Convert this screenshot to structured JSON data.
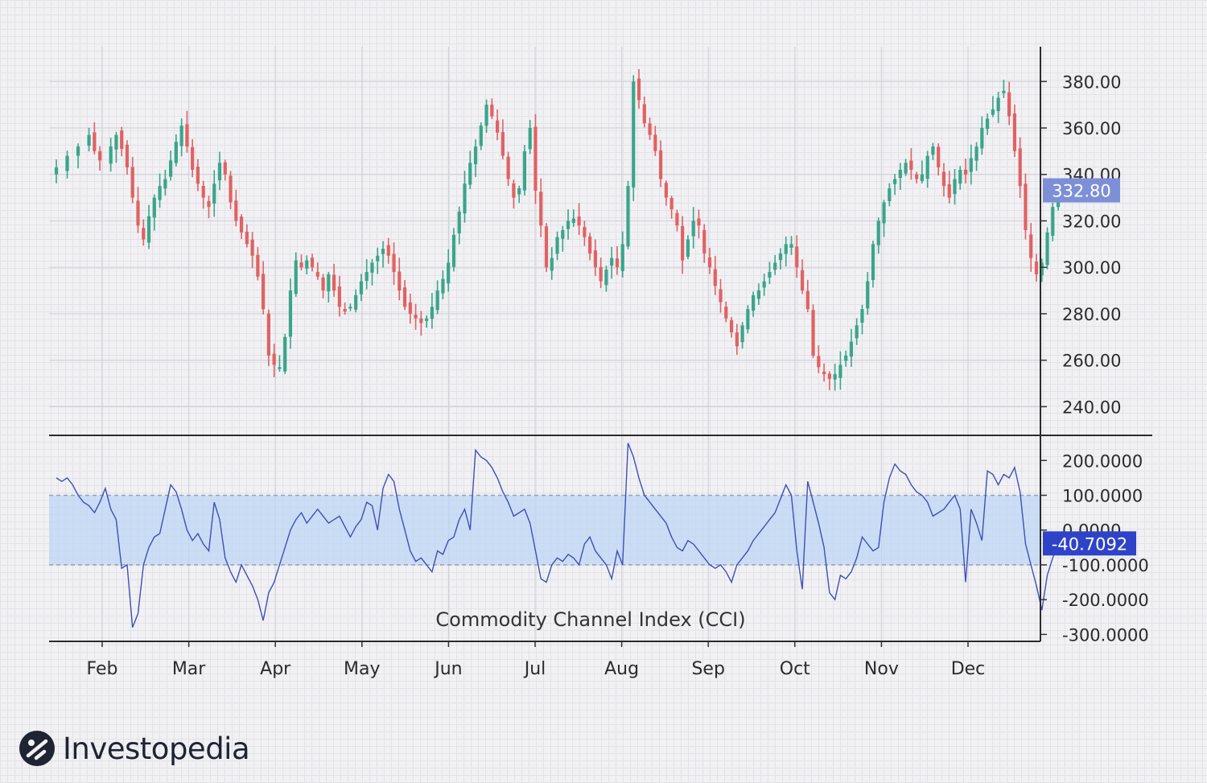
{
  "chart_data": [
    {
      "type": "candlestick",
      "title": "",
      "months": [
        "Feb",
        "Mar",
        "Apr",
        "May",
        "Jun",
        "Jul",
        "Aug",
        "Sep",
        "Oct",
        "Nov",
        "Dec"
      ],
      "ylim": [
        228,
        395
      ],
      "y_ticks": [
        "240.00",
        "260.00",
        "280.00",
        "300.00",
        "320.00",
        "340.00",
        "360.00",
        "380.00"
      ],
      "last_price_label": "332.80",
      "last_price": 332.8,
      "colors": {
        "up": "#3aa58a",
        "down": "#e06262",
        "last_price_badge": "#7d8fd6"
      },
      "close_series": [
        [
          0,
          343
        ],
        [
          2,
          348
        ],
        [
          4,
          352
        ],
        [
          6,
          357
        ],
        [
          7,
          350
        ],
        [
          8,
          346
        ],
        [
          10,
          352
        ],
        [
          11,
          357
        ],
        [
          12,
          351
        ],
        [
          13,
          343
        ],
        [
          14,
          330
        ],
        [
          15,
          318
        ],
        [
          16,
          312
        ],
        [
          17,
          322
        ],
        [
          18,
          330
        ],
        [
          19,
          335
        ],
        [
          20,
          338
        ],
        [
          21,
          346
        ],
        [
          22,
          354
        ],
        [
          23,
          361
        ],
        [
          24,
          352
        ],
        [
          25,
          342
        ],
        [
          26,
          336
        ],
        [
          27,
          330
        ],
        [
          28,
          326
        ],
        [
          29,
          336
        ],
        [
          30,
          345
        ],
        [
          31,
          340
        ],
        [
          32,
          328
        ],
        [
          33,
          320
        ],
        [
          34,
          315
        ],
        [
          35,
          310
        ],
        [
          36,
          305
        ],
        [
          37,
          296
        ],
        [
          38,
          282
        ],
        [
          39,
          262
        ],
        [
          40,
          258
        ],
        [
          41,
          257
        ],
        [
          42,
          270
        ],
        [
          43,
          290
        ],
        [
          44,
          303
        ],
        [
          45,
          300
        ],
        [
          46,
          303
        ],
        [
          47,
          300
        ],
        [
          48,
          296
        ],
        [
          49,
          290
        ],
        [
          50,
          297
        ],
        [
          51,
          290
        ],
        [
          52,
          283
        ],
        [
          53,
          281
        ],
        [
          54,
          283
        ],
        [
          55,
          288
        ],
        [
          56,
          294
        ],
        [
          57,
          298
        ],
        [
          58,
          302
        ],
        [
          59,
          305
        ],
        [
          60,
          308
        ],
        [
          61,
          305
        ],
        [
          62,
          298
        ],
        [
          63,
          290
        ],
        [
          64,
          283
        ],
        [
          65,
          280
        ],
        [
          66,
          278
        ],
        [
          67,
          276
        ],
        [
          68,
          278
        ],
        [
          69,
          283
        ],
        [
          70,
          290
        ],
        [
          71,
          295
        ],
        [
          72,
          302
        ],
        [
          73,
          314
        ],
        [
          74,
          324
        ],
        [
          75,
          336
        ],
        [
          76,
          345
        ],
        [
          77,
          352
        ],
        [
          78,
          361
        ],
        [
          79,
          370
        ],
        [
          80,
          365
        ],
        [
          81,
          358
        ],
        [
          82,
          348
        ],
        [
          83,
          338
        ],
        [
          84,
          330
        ],
        [
          85,
          334
        ],
        [
          86,
          350
        ],
        [
          87,
          360
        ],
        [
          88,
          333
        ],
        [
          89,
          318
        ],
        [
          90,
          300
        ],
        [
          91,
          304
        ],
        [
          92,
          313
        ],
        [
          93,
          316
        ],
        [
          94,
          320
        ],
        [
          95,
          321
        ],
        [
          96,
          318
        ],
        [
          97,
          313
        ],
        [
          98,
          306
        ],
        [
          99,
          300
        ],
        [
          100,
          294
        ],
        [
          101,
          299
        ],
        [
          102,
          304
        ],
        [
          103,
          300
        ],
        [
          104,
          310
        ],
        [
          105,
          335
        ],
        [
          106,
          380
        ],
        [
          107,
          372
        ],
        [
          108,
          362
        ],
        [
          109,
          357
        ],
        [
          110,
          350
        ],
        [
          111,
          338
        ],
        [
          112,
          330
        ],
        [
          113,
          325
        ],
        [
          114,
          318
        ],
        [
          115,
          303
        ],
        [
          116,
          312
        ],
        [
          117,
          320
        ],
        [
          118,
          318
        ],
        [
          119,
          306
        ],
        [
          120,
          300
        ],
        [
          121,
          292
        ],
        [
          122,
          285
        ],
        [
          123,
          278
        ],
        [
          124,
          272
        ],
        [
          125,
          266
        ],
        [
          126,
          275
        ],
        [
          127,
          282
        ],
        [
          128,
          288
        ],
        [
          129,
          290
        ],
        [
          130,
          294
        ],
        [
          131,
          298
        ],
        [
          132,
          302
        ],
        [
          133,
          306
        ],
        [
          134,
          310
        ],
        [
          135,
          310
        ],
        [
          136,
          300
        ],
        [
          137,
          290
        ],
        [
          138,
          282
        ],
        [
          139,
          262
        ],
        [
          140,
          257
        ],
        [
          141,
          254
        ],
        [
          142,
          252
        ],
        [
          143,
          254
        ],
        [
          144,
          258
        ],
        [
          145,
          262
        ],
        [
          146,
          268
        ],
        [
          147,
          275
        ],
        [
          148,
          282
        ],
        [
          149,
          294
        ],
        [
          150,
          310
        ],
        [
          151,
          320
        ],
        [
          152,
          328
        ],
        [
          153,
          334
        ],
        [
          154,
          338
        ],
        [
          155,
          342
        ],
        [
          156,
          345
        ],
        [
          157,
          342
        ],
        [
          158,
          338
        ],
        [
          159,
          340
        ],
        [
          160,
          348
        ],
        [
          161,
          352
        ],
        [
          162,
          343
        ],
        [
          163,
          335
        ],
        [
          164,
          330
        ],
        [
          165,
          338
        ],
        [
          166,
          342
        ],
        [
          167,
          340
        ],
        [
          168,
          347
        ],
        [
          169,
          352
        ],
        [
          170,
          360
        ],
        [
          171,
          364
        ],
        [
          172,
          368
        ],
        [
          173,
          373
        ],
        [
          174,
          376
        ],
        [
          175,
          365
        ],
        [
          176,
          350
        ],
        [
          177,
          335
        ],
        [
          178,
          316
        ],
        [
          179,
          304
        ],
        [
          180,
          297
        ],
        [
          181,
          302
        ],
        [
          182,
          315
        ],
        [
          183,
          326
        ],
        [
          184,
          333
        ]
      ]
    },
    {
      "type": "line",
      "title": "Commodity Channel Index (CCI)",
      "series": [
        {
          "name": "Commodity Channel Index (CCI)"
        }
      ],
      "ylim": [
        -320,
        270
      ],
      "y_ticks": [
        "200.0000",
        "100.0000",
        "0.0000",
        "-100.0000",
        "-200.0000",
        "-300.0000"
      ],
      "band": [
        -100,
        100
      ],
      "last_value_label": "-40.7092",
      "last_value": -40.7092,
      "colors": {
        "line": "#3f4fb5",
        "band_fill": "#bcd6f5",
        "band_edge": "#9aa0b6",
        "last_value_badge": "#2f43c9"
      },
      "points": [
        [
          0,
          150
        ],
        [
          1,
          140
        ],
        [
          2,
          150
        ],
        [
          3,
          130
        ],
        [
          4,
          100
        ],
        [
          5,
          80
        ],
        [
          6,
          70
        ],
        [
          7,
          50
        ],
        [
          8,
          80
        ],
        [
          9,
          120
        ],
        [
          10,
          60
        ],
        [
          11,
          30
        ],
        [
          12,
          -110
        ],
        [
          13,
          -100
        ],
        [
          14,
          -280
        ],
        [
          15,
          -240
        ],
        [
          16,
          -100
        ],
        [
          17,
          -50
        ],
        [
          18,
          -20
        ],
        [
          19,
          -10
        ],
        [
          20,
          60
        ],
        [
          21,
          130
        ],
        [
          22,
          110
        ],
        [
          23,
          60
        ],
        [
          24,
          0
        ],
        [
          25,
          -30
        ],
        [
          26,
          -10
        ],
        [
          27,
          -40
        ],
        [
          28,
          -60
        ],
        [
          29,
          80
        ],
        [
          30,
          30
        ],
        [
          31,
          -80
        ],
        [
          32,
          -120
        ],
        [
          33,
          -150
        ],
        [
          34,
          -100
        ],
        [
          35,
          -130
        ],
        [
          36,
          -160
        ],
        [
          37,
          -200
        ],
        [
          38,
          -260
        ],
        [
          39,
          -180
        ],
        [
          40,
          -150
        ],
        [
          41,
          -100
        ],
        [
          42,
          -50
        ],
        [
          43,
          0
        ],
        [
          44,
          30
        ],
        [
          45,
          50
        ],
        [
          46,
          20
        ],
        [
          47,
          40
        ],
        [
          48,
          60
        ],
        [
          49,
          40
        ],
        [
          50,
          20
        ],
        [
          51,
          30
        ],
        [
          52,
          40
        ],
        [
          53,
          10
        ],
        [
          54,
          -20
        ],
        [
          55,
          10
        ],
        [
          56,
          30
        ],
        [
          57,
          80
        ],
        [
          58,
          70
        ],
        [
          59,
          0
        ],
        [
          60,
          120
        ],
        [
          61,
          160
        ],
        [
          62,
          140
        ],
        [
          63,
          60
        ],
        [
          64,
          0
        ],
        [
          65,
          -60
        ],
        [
          66,
          -90
        ],
        [
          67,
          -80
        ],
        [
          68,
          -100
        ],
        [
          69,
          -120
        ],
        [
          70,
          -60
        ],
        [
          71,
          -70
        ],
        [
          72,
          -30
        ],
        [
          73,
          -20
        ],
        [
          74,
          30
        ],
        [
          75,
          60
        ],
        [
          76,
          0
        ],
        [
          77,
          230
        ],
        [
          78,
          210
        ],
        [
          79,
          200
        ],
        [
          80,
          180
        ],
        [
          81,
          150
        ],
        [
          82,
          110
        ],
        [
          83,
          80
        ],
        [
          84,
          40
        ],
        [
          85,
          50
        ],
        [
          86,
          60
        ],
        [
          87,
          20
        ],
        [
          88,
          -60
        ],
        [
          89,
          -140
        ],
        [
          90,
          -150
        ],
        [
          91,
          -100
        ],
        [
          92,
          -80
        ],
        [
          93,
          -90
        ],
        [
          94,
          -70
        ],
        [
          95,
          -80
        ],
        [
          96,
          -100
        ],
        [
          97,
          -40
        ],
        [
          98,
          -20
        ],
        [
          99,
          -60
        ],
        [
          100,
          -80
        ],
        [
          101,
          -100
        ],
        [
          102,
          -140
        ],
        [
          103,
          -60
        ],
        [
          104,
          -100
        ],
        [
          105,
          250
        ],
        [
          106,
          210
        ],
        [
          107,
          150
        ],
        [
          108,
          100
        ],
        [
          109,
          80
        ],
        [
          110,
          60
        ],
        [
          111,
          40
        ],
        [
          112,
          20
        ],
        [
          113,
          -20
        ],
        [
          114,
          -50
        ],
        [
          115,
          -60
        ],
        [
          116,
          -30
        ],
        [
          117,
          -40
        ],
        [
          118,
          -60
        ],
        [
          119,
          -80
        ],
        [
          120,
          -100
        ],
        [
          121,
          -110
        ],
        [
          122,
          -100
        ],
        [
          123,
          -120
        ],
        [
          124,
          -150
        ],
        [
          125,
          -100
        ],
        [
          126,
          -80
        ],
        [
          127,
          -60
        ],
        [
          128,
          -30
        ],
        [
          129,
          -10
        ],
        [
          130,
          10
        ],
        [
          131,
          30
        ],
        [
          132,
          50
        ],
        [
          133,
          90
        ],
        [
          134,
          130
        ],
        [
          135,
          100
        ],
        [
          136,
          -60
        ],
        [
          137,
          -170
        ],
        [
          138,
          140
        ],
        [
          139,
          80
        ],
        [
          140,
          20
        ],
        [
          141,
          -50
        ],
        [
          142,
          -180
        ],
        [
          143,
          -200
        ],
        [
          144,
          -130
        ],
        [
          145,
          -140
        ],
        [
          146,
          -120
        ],
        [
          147,
          -80
        ],
        [
          148,
          -20
        ],
        [
          149,
          -40
        ],
        [
          150,
          -60
        ],
        [
          151,
          -50
        ],
        [
          152,
          80
        ],
        [
          153,
          150
        ],
        [
          154,
          190
        ],
        [
          155,
          170
        ],
        [
          156,
          160
        ],
        [
          157,
          130
        ],
        [
          158,
          110
        ],
        [
          159,
          100
        ],
        [
          160,
          80
        ],
        [
          161,
          40
        ],
        [
          162,
          50
        ],
        [
          163,
          60
        ],
        [
          164,
          80
        ],
        [
          165,
          100
        ],
        [
          166,
          60
        ],
        [
          167,
          -150
        ],
        [
          168,
          60
        ],
        [
          169,
          20
        ],
        [
          170,
          -30
        ],
        [
          171,
          170
        ],
        [
          172,
          160
        ],
        [
          173,
          130
        ],
        [
          174,
          160
        ],
        [
          175,
          150
        ],
        [
          176,
          180
        ],
        [
          177,
          110
        ],
        [
          178,
          -40
        ],
        [
          179,
          -100
        ],
        [
          180,
          -160
        ],
        [
          181,
          -230
        ],
        [
          182,
          -130
        ],
        [
          183,
          -80
        ],
        [
          184,
          -40.7092
        ]
      ]
    }
  ],
  "brand": {
    "name": "Investopedia"
  }
}
